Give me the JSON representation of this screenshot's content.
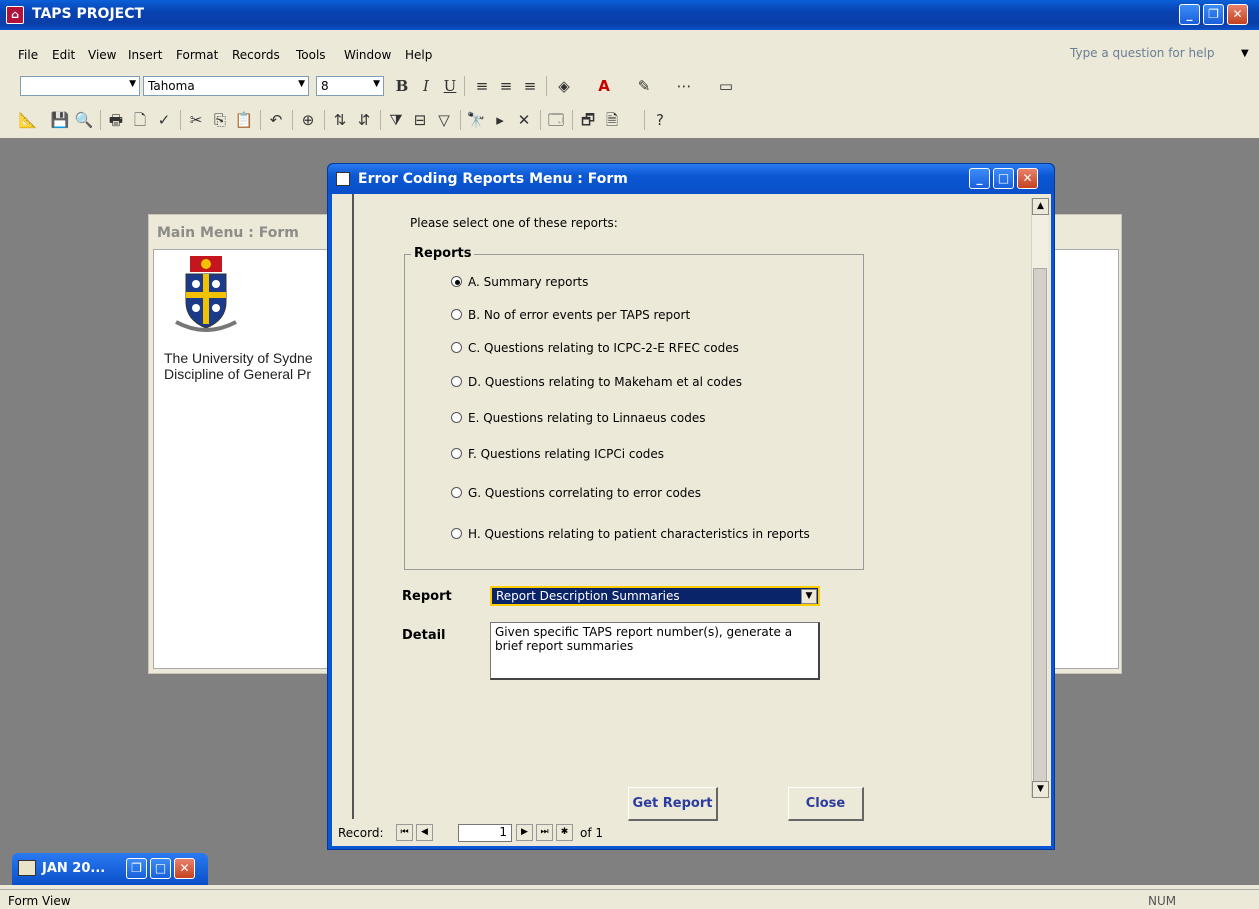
{
  "app": {
    "title": "TAPS PROJECT"
  },
  "menu": [
    "File",
    "Edit",
    "View",
    "Insert",
    "Format",
    "Records",
    "Tools",
    "Window",
    "Help"
  ],
  "help_box": {
    "placeholder": "Type a question for help"
  },
  "format_toolbar": {
    "object_combo": "",
    "font": "Tahoma",
    "size": "8"
  },
  "background_form": {
    "title": "Main Menu : Form",
    "line1": "The University of Sydne",
    "line2": "Discipline of General Pr"
  },
  "dialog": {
    "title": "Error Coding Reports Menu : Form",
    "prompt": "Please select one of these reports:",
    "group_label": "Reports",
    "options": [
      {
        "label": "A. Summary reports",
        "selected": true
      },
      {
        "label": "B. No of error events per TAPS report",
        "selected": false
      },
      {
        "label": "C. Questions relating to ICPC-2-E RFEC codes",
        "selected": false
      },
      {
        "label": "D. Questions relating to Makeham et al codes",
        "selected": false
      },
      {
        "label": "E. Questions relating to Linnaeus codes",
        "selected": false
      },
      {
        "label": "F. Questions relating ICPCi  codes",
        "selected": false
      },
      {
        "label": "G. Questions correlating to error codes",
        "selected": false
      },
      {
        "label": "H. Questions relating to patient characteristics in reports",
        "selected": false
      }
    ],
    "report_label": "Report",
    "report_value": "Report Description Summaries",
    "detail_label": "Detail",
    "detail_value": "Given specific TAPS report number(s), generate a brief report summaries",
    "get_report_button": "Get Report",
    "close_button": "Close",
    "record_label": "Record:",
    "record_current": "1",
    "record_total": "of 1"
  },
  "minimized_window": {
    "title": "JAN 20..."
  },
  "status": {
    "left": "Form View",
    "right": "NUM"
  }
}
